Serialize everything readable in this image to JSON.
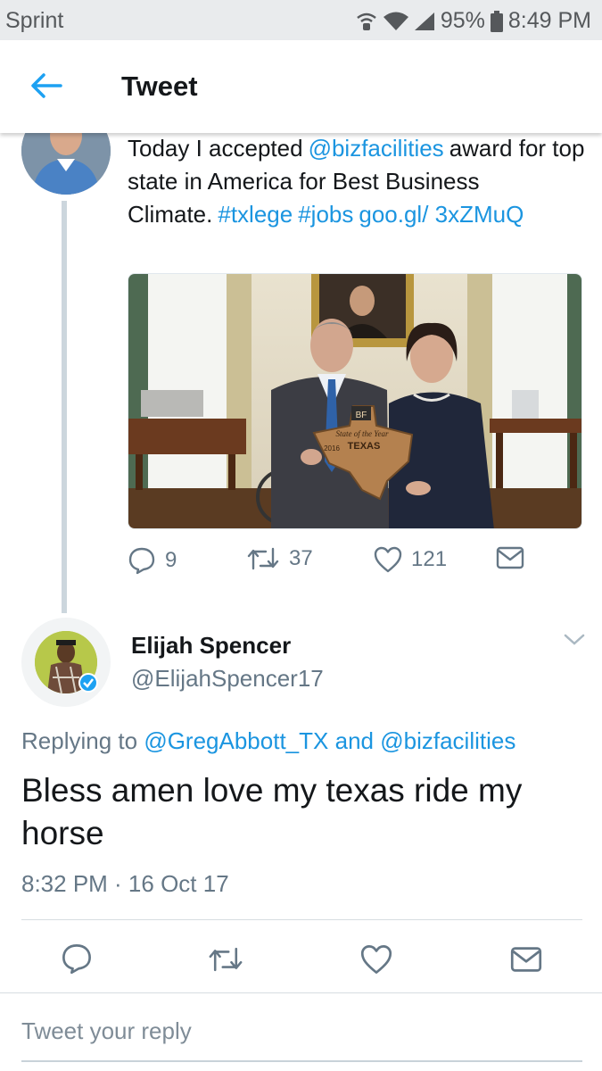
{
  "status_bar": {
    "carrier": "Sprint",
    "battery": "95%",
    "time": "8:49 PM"
  },
  "header": {
    "title": "Tweet",
    "back_icon": "arrow-left-icon"
  },
  "original_tweet": {
    "text": {
      "part1": "Today I accepted",
      "mention": "@bizfacilities",
      "part2": "award for top state in America for Best Business Climate.",
      "hashtag1": "#txlege",
      "hashtag2": "#jobs",
      "link": "goo.gl/ 3xZMuQ"
    },
    "photo_text": {
      "plaque_brand": "BF",
      "plaque_title": "State of the Year",
      "plaque_state": "TEXAS",
      "plaque_year": "2016"
    },
    "actions": {
      "replies": "9",
      "retweets": "37",
      "likes": "121"
    }
  },
  "reply_tweet": {
    "name": "Elijah Spencer",
    "handle": "@ElijahSpencer17",
    "replying_prefix": "Replying to",
    "replying_to_1": "@GregAbbott_TX",
    "replying_and": "and",
    "replying_to_2": "@bizfacilities",
    "body": "Bless amen love my texas ride my horse",
    "timestamp": "8:32 PM · 16 Oct 17"
  },
  "reply_box": {
    "placeholder": "Tweet your reply"
  },
  "colors": {
    "link": "#1b95e0",
    "muted": "#657786",
    "text": "#14171a"
  }
}
